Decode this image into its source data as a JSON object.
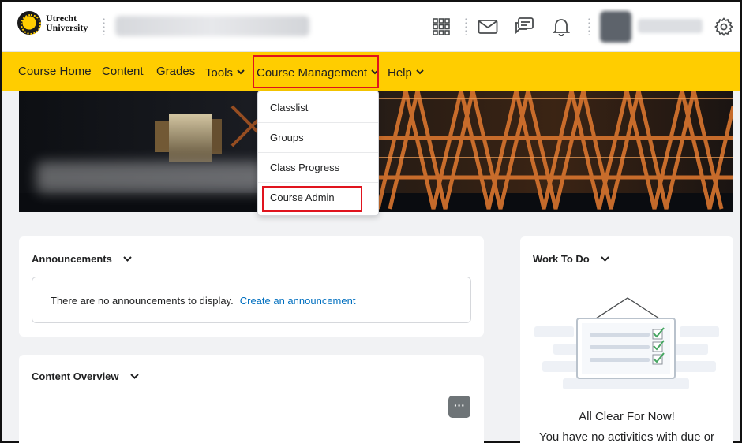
{
  "brand": {
    "line1": "Utrecht",
    "line2": "University"
  },
  "icons": {
    "apps": "grid-icon",
    "mail": "envelope-icon",
    "chat": "chat-bubble-icon",
    "notifications": "bell-icon",
    "settings": "gear-icon"
  },
  "nav": {
    "items": [
      {
        "label": "Course Home"
      },
      {
        "label": "Content"
      },
      {
        "label": "Grades"
      },
      {
        "label": "Tools"
      },
      {
        "label": "Course Management"
      },
      {
        "label": "Help"
      }
    ]
  },
  "dropdown": {
    "items": [
      {
        "label": "Classlist"
      },
      {
        "label": "Groups"
      },
      {
        "label": "Class Progress"
      },
      {
        "label": "Course Admin"
      }
    ]
  },
  "announcements": {
    "title": "Announcements",
    "empty_text": "There are no announcements to display.",
    "create_link": "Create an announcement"
  },
  "content_overview": {
    "title": "Content Overview",
    "more_label": "···"
  },
  "work_to_do": {
    "title": "Work To Do",
    "headline": "All Clear For Now!",
    "subtext": "You have no activities with due or"
  },
  "colors": {
    "nav_bg": "#ffcd00",
    "link": "#006fbf",
    "highlight": "#e0141e"
  }
}
